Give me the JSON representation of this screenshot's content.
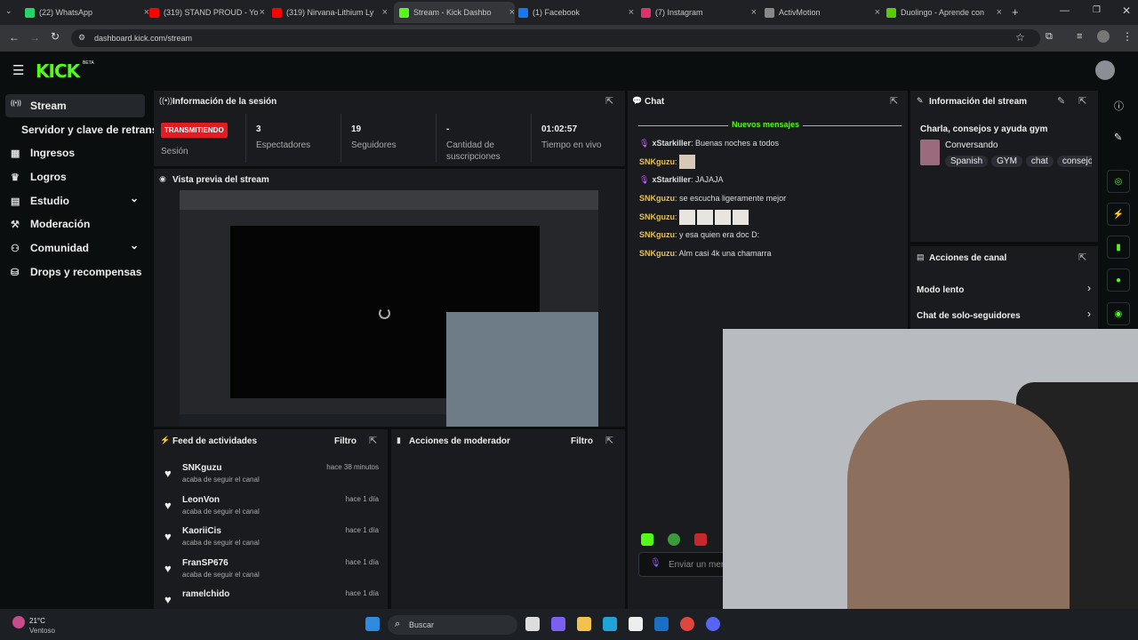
{
  "browser": {
    "tabs": [
      {
        "label": "(22) WhatsApp",
        "color": "#25d366"
      },
      {
        "label": "(319) STAND PROUD - Yo",
        "color": "#ff0000"
      },
      {
        "label": "(319) Nirvana-Lithium Ly",
        "color": "#ff0000"
      },
      {
        "label": "Stream - Kick Dashbo",
        "color": "#53fc18"
      },
      {
        "label": "(1) Facebook",
        "color": "#1877f2"
      },
      {
        "label": "(7) Instagram",
        "color": "#e1306c"
      },
      {
        "label": "ActivMotion",
        "color": "#888888"
      },
      {
        "label": "Duolingo - Aprende con",
        "color": "#58cc02"
      }
    ],
    "url": "dashboard.kick.com/stream"
  },
  "brand": {
    "logo": "KICK",
    "beta": "BETA",
    "accent": "#53fc18"
  },
  "sidebar": {
    "items": [
      {
        "label": "Stream",
        "icon": "broadcast-icon"
      },
      {
        "label": "Servidor y clave de retransm",
        "icon": ""
      },
      {
        "label": "Ingresos",
        "icon": "chart-icon"
      },
      {
        "label": "Logros",
        "icon": "trophy-icon"
      },
      {
        "label": "Estudio",
        "icon": "grid-icon"
      },
      {
        "label": "Moderación",
        "icon": "hammer-icon"
      },
      {
        "label": "Comunidad",
        "icon": "users-icon"
      },
      {
        "label": "Drops y recompensas",
        "icon": "gift-icon"
      }
    ]
  },
  "session": {
    "title": "Información de la sesión",
    "status": "TRANSMITIENDO",
    "status_label": "Sesión",
    "viewers": "3",
    "viewers_label": "Espectadores",
    "followers": "19",
    "followers_label": "Seguidores",
    "subs": "-",
    "subs_label": "Cantidad de suscripciones",
    "uptime": "01:02:57",
    "uptime_label": "Tiempo en vivo"
  },
  "preview": {
    "title": "Vista previa del stream"
  },
  "feed": {
    "title": "Feed de actividades",
    "filter": "Filtro",
    "items": [
      {
        "name": "SNKguzu",
        "sub": "acaba de seguir el canal",
        "time": "hace 38 minutos"
      },
      {
        "name": "LeonVon",
        "sub": "acaba de seguir el canal",
        "time": "hace 1 día"
      },
      {
        "name": "KaoriiCis",
        "sub": "acaba de seguir el canal",
        "time": "hace 1 día"
      },
      {
        "name": "FranSP676",
        "sub": "acaba de seguir el canal",
        "time": "hace 1 día"
      },
      {
        "name": "ramelchido",
        "sub": "",
        "time": "hace 1 día"
      }
    ]
  },
  "modactions": {
    "title": "Acciones de moderador",
    "filter": "Filtro"
  },
  "chat": {
    "title": "Chat",
    "new_messages": "Nuevos mensajes",
    "messages": [
      {
        "user": "xStarkiller",
        "text": "Buenas noches a todos"
      },
      {
        "user": "SNKguzu",
        "text": ""
      },
      {
        "user": "xStarkiller",
        "text": "JAJAJA"
      },
      {
        "user": "SNKguzu",
        "text": "se escucha ligeramente mejor"
      },
      {
        "user": "SNKguzu",
        "text": ""
      },
      {
        "user": "SNKguzu",
        "text": "y esa quien era doc D:"
      },
      {
        "user": "SNKguzu",
        "text": "Alm casi 4k una chamarra"
      }
    ],
    "input_placeholder": "Enviar un mensaje"
  },
  "streaminfo": {
    "title": "Información del stream",
    "stream_title": "Charla, consejos y ayuda gym",
    "category": "Conversando",
    "tags": [
      "Spanish",
      "GYM",
      "chat",
      "consejos"
    ]
  },
  "channel_actions": {
    "title": "Acciones de canal",
    "items": [
      "Modo lento",
      "Chat de solo-seguidores"
    ]
  },
  "taskbar": {
    "weather_temp": "21°C",
    "weather_desc": "Ventoso",
    "search": "Buscar"
  }
}
